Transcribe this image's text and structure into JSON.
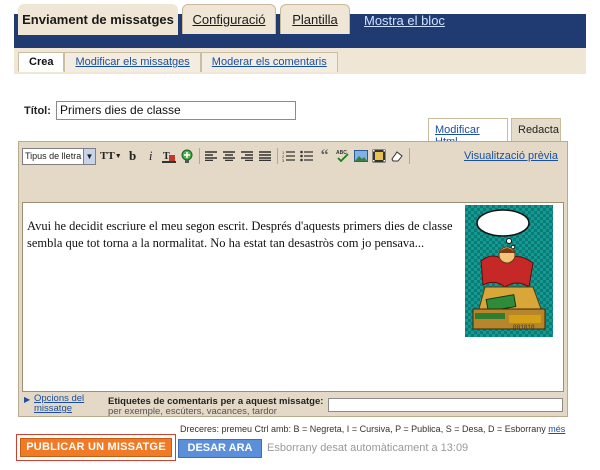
{
  "tabs": [
    {
      "label": "Enviament de missatges",
      "active": true
    },
    {
      "label": "Configuració",
      "active": false
    },
    {
      "label": "Plantilla",
      "active": false
    }
  ],
  "view_blog": "Mostra el  bloc",
  "subtabs": [
    {
      "label": "Crea",
      "active": true
    },
    {
      "label": "Modificar els missatges",
      "active": false
    },
    {
      "label": "Moderar els comentaris",
      "active": false
    }
  ],
  "title": {
    "label": "Títol:",
    "value": "Primers dies de classe"
  },
  "modes": {
    "html": "Modificar Html",
    "compose": "Redacta"
  },
  "toolbar": {
    "font_select": "Tipus de lletra",
    "font_size_icon": "TT",
    "bold": "b",
    "italic": "i",
    "preview": "Visualització prèvia"
  },
  "body_text": "Avui he decidit escriure el meu segon escrit. Després d'aquests primers dies de classe sembla que tot torna a la normalitat. No ha estat tan desastròs com jo pensava...",
  "options": {
    "link": "Opcions del missatge",
    "labels_title": "Etiquetes de comentaris per a aquest missatge:",
    "labels_hint": "per exemple, escúters, vacances, tardor",
    "labels_value": ""
  },
  "shortcuts": {
    "text": "Dreceres: premeu Ctrl amb: B = Negreta, I = Cursiva, P = Publica, S = Desa, D = Esborrany",
    "more": "més"
  },
  "actions": {
    "publish": "PUBLICAR UN MISSATGE",
    "save": "DESAR ARA",
    "autosave": "Esborrany desat automàticament a 13:09"
  },
  "colors": {
    "topbar": "#1f3b72",
    "tab_bg": "#efe6d6",
    "publish": "#f07a26",
    "save": "#5b8fd9",
    "link": "#1a4fa0"
  },
  "image_text": "001010"
}
